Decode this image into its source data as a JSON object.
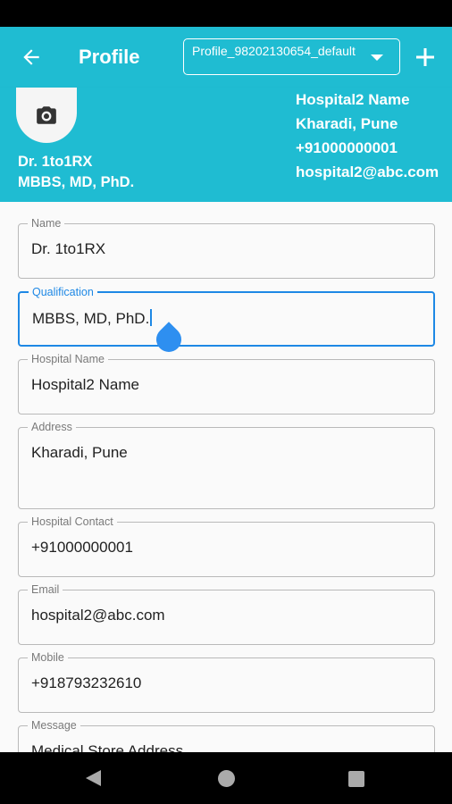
{
  "app": {
    "title": "Profile",
    "profile_selector": {
      "value": "Profile_98202130654_default"
    }
  },
  "header": {
    "doctor_name": "Dr. 1to1RX",
    "doctor_qualification": "MBBS, MD, PhD.",
    "hospital_lines": [
      "Hospital2 Name",
      "Kharadi, Pune",
      "+91000000001",
      "hospital2@abc.com"
    ]
  },
  "form": {
    "fields": [
      {
        "label": "Name",
        "value": "Dr. 1to1RX"
      },
      {
        "label": "Qualification",
        "value": "MBBS, MD, PhD."
      },
      {
        "label": "Hospital Name",
        "value": "Hospital2 Name"
      },
      {
        "label": "Address",
        "value": "Kharadi, Pune"
      },
      {
        "label": "Hospital Contact",
        "value": "+91000000001"
      },
      {
        "label": "Email",
        "value": "hospital2@abc.com"
      },
      {
        "label": "Mobile",
        "value": "+918793232610"
      },
      {
        "label": "Message",
        "value": "Medical Store Address"
      }
    ]
  },
  "icons": {
    "back": "arrow-left-icon",
    "add": "plus-icon",
    "avatar": "camera-icon",
    "dropdown": "caret-down-icon"
  },
  "colors": {
    "app_bar": "#1fbcd2",
    "focus": "#1e88e5",
    "field_border": "#b9b9b9"
  }
}
